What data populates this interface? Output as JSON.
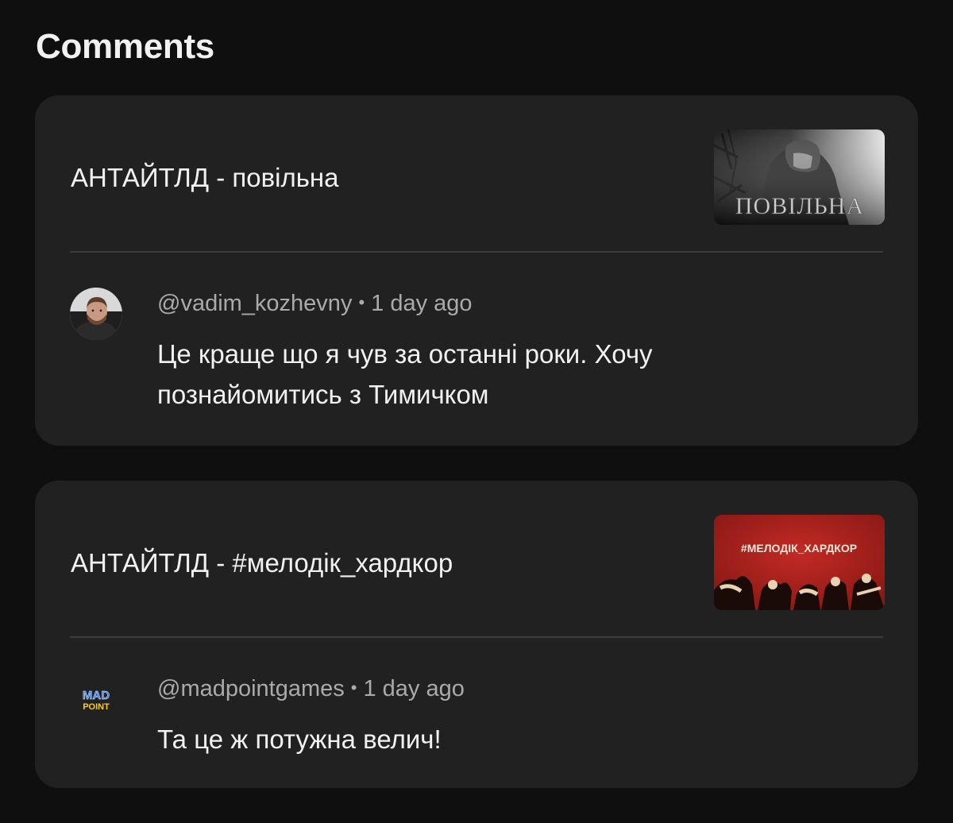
{
  "page": {
    "title": "Comments"
  },
  "comments": [
    {
      "video_title": "АНТАЙТЛД - повільна",
      "thumbnail_text": "ПОВІЛЬНА",
      "author": "@vadim_kozhevny",
      "separator": "•",
      "time": "1 day ago",
      "text": "Це краще що я чув за останні роки. Хочу познайомитись з Тимичком",
      "avatar_icon": "person-photo-avatar"
    },
    {
      "video_title": "АНТАЙТЛД - #мелодік_хардкор",
      "thumbnail_text": "#МЕЛОДІК_ХАРДКОР",
      "author": "@madpointgames",
      "separator": "•",
      "time": "1 day ago",
      "text": "Та це ж потужна велич!",
      "avatar_icon": "madpoint-logo-avatar",
      "avatar_logo_top": "MAD",
      "avatar_logo_bottom": "POINT"
    }
  ],
  "colors": {
    "background": "#0f0f0f",
    "card": "#212121",
    "divider": "#3d3d3d",
    "text_primary": "#f1f1f1",
    "text_secondary": "#aaaaaa",
    "thumb2_red": "#b3221d",
    "logo_blue": "#3b82f6",
    "logo_yellow": "#facc15"
  }
}
